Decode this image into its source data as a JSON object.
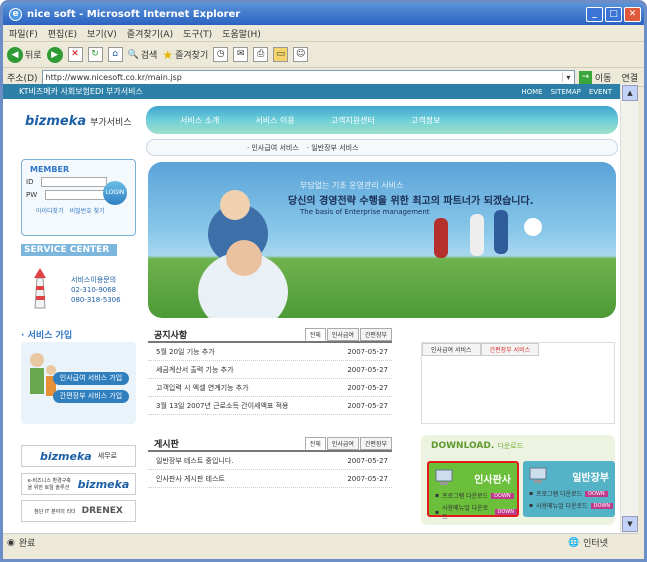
{
  "window": {
    "title": "nice soft - Microsoft Internet Explorer"
  },
  "menu": [
    "파일(F)",
    "편집(E)",
    "보기(V)",
    "즐겨찾기(A)",
    "도구(T)",
    "도움말(H)"
  ],
  "toolbar": {
    "back": "뒤로",
    "search": "검색",
    "favorites": "즐겨찾기"
  },
  "address": {
    "label": "주소(D)",
    "url": "http://www.nicesoft.co.kr/main.jsp",
    "go": "이동",
    "links": "연결"
  },
  "site": {
    "topbar": "KT비즈메카 사회보험EDI 부가서비스",
    "toplinks": [
      "HOME",
      "SITEMAP",
      "EVENT"
    ],
    "logo": "bizmeka",
    "logo_sub": "부가서비스",
    "gnb": [
      "서비스 소개",
      "서비스 이용",
      "고객지원센터",
      "고객정보"
    ],
    "subnav": [
      "인사급여 서비스",
      "일반장부 서비스"
    ],
    "member": {
      "title": "MEMBER",
      "id": "ID",
      "pw": "PW",
      "login": "LOGIN",
      "find_id": "아이디찾기",
      "find_pw": "비밀번호 찾기"
    },
    "service_center": {
      "title": "SERVICE CENTER",
      "label": "서비스이용문의",
      "phone1": "02-310-9068",
      "phone2": "080-318-5306"
    },
    "join": {
      "title": "서비스 가입",
      "btn1": "인사급여 서비스 가입",
      "btn2": "간편장부 서비스 가입"
    },
    "banners": [
      {
        "brand": "bizmeka",
        "text": "세무로"
      },
      {
        "brand": "bizmeka",
        "text": "e-비즈니스 환경구축을 위한 토탈 솔루션"
      },
      {
        "brand": "DRENEX",
        "text": "첨단 IT 분야의 리더"
      }
    ],
    "hero": {
      "line1": "부담없는 기초 운영관리 서비스",
      "line2": "당신의 경영전략 수행을 위한 최고의 파트너가 되겠습니다.",
      "line3": "The basis of Enterprise management"
    },
    "notice": {
      "title": "공지사항",
      "tabs": [
        "전체",
        "인사급여",
        "간편장부"
      ],
      "items": [
        {
          "t": "5월 20일 기능 추가",
          "d": "2007-05-27"
        },
        {
          "t": "세금계산서 출력 기능 추가",
          "d": "2007-05-27"
        },
        {
          "t": "고객입력 시 엑셀 연계기능 추가",
          "d": "2007-05-27"
        },
        {
          "t": "3월 13일 2007년 근로소득 간이세액표 적용",
          "d": "2007-05-27"
        }
      ]
    },
    "board": {
      "title": "게시판",
      "tabs": [
        "전체",
        "인사급여",
        "간편장부"
      ],
      "items": [
        {
          "t": "일반장부 테스트 중입니다.",
          "d": "2007-05-27"
        },
        {
          "t": "인사판사 게시판 테스트",
          "d": "2007-05-27"
        }
      ]
    },
    "rtabs": [
      "인사급여 서비스",
      "간편장부 서비스"
    ],
    "download": {
      "title": "DOWNLOAD.",
      "title_sub": "다운로드",
      "items": [
        {
          "name": "인사판사",
          "r1": "프로그램 다운로드",
          "r2": "사용메뉴얼 다운로드",
          "btn": "DOWN"
        },
        {
          "name": "일반장부",
          "r1": "프로그램 다운로드",
          "r2": "사용메뉴얼 다운로드",
          "btn": "DOWN"
        }
      ]
    }
  },
  "status": {
    "left": "완료",
    "zone": "인터넷"
  }
}
